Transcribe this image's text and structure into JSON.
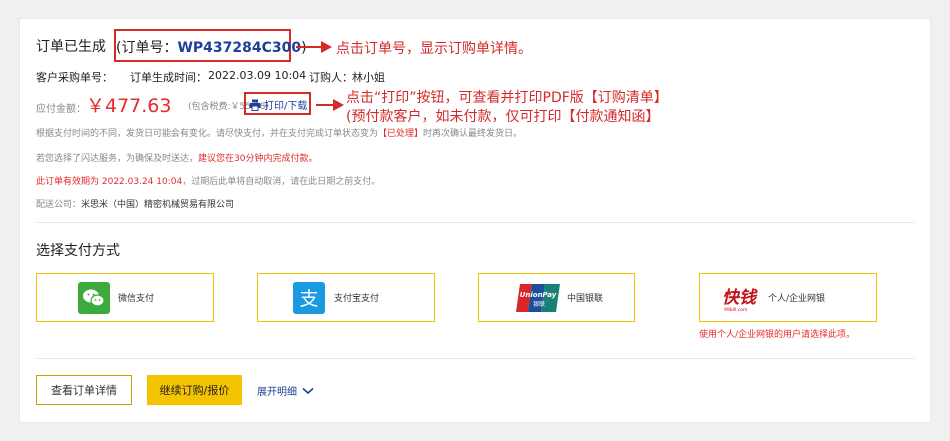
{
  "order": {
    "status_title": "订单已生成",
    "order_no_prefix": "(订单号：",
    "order_no": "WP437284C300",
    "order_no_suffix": ")",
    "annotation_order": "点击订单号，显示订购单详情。",
    "customer_po_label": "客户采购单号：",
    "created_time_label": "订单生成时间：",
    "created_time": "2022.03.09 10:04",
    "orderer_label": "订购人：",
    "orderer": "林小姐",
    "amount_label": "应付金额：",
    "amount": "￥477.63",
    "tax_note": "(包含税费:￥55.08)",
    "print_button": "打印/下载",
    "annotation_print_line1": "点击“打印”按钮，可查看并打印PDF版【订购清单】",
    "annotation_print_line2": "(预付款客户，如未付款，仅可打印【付款通知函】",
    "delivery_note_a": "根据支付时间的不同，发货日可能会有变化。请尽快支付，并在支付完成订单状态变为",
    "delivery_note_highlight": "【已处理】",
    "delivery_note_b": "时再次确认最终发货日。",
    "flash_note_a": "若您选择了闪达服务，为确保及时送达，",
    "flash_note_highlight": "建议您在30分钟内完成付款。",
    "validity_label": "此订单有效期为 2022.03.24 10:04",
    "validity_note": "，过期后此单将自动取消，请在此日期之前支付。",
    "shipper_label": "配送公司：",
    "shipper": "米思米（中国）精密机械贸易有限公司"
  },
  "payment": {
    "section_title": "选择支付方式",
    "methods": [
      {
        "label": "微信支付",
        "icon": "wechat-pay-icon"
      },
      {
        "label": "支付宝支付",
        "icon": "alipay-icon"
      },
      {
        "label": "中国银联",
        "icon": "unionpay-icon"
      },
      {
        "label": "个人/企业网银",
        "icon": "kuaiqian-icon"
      }
    ],
    "unionpay_logo_text": "UnionPay",
    "unionpay_logo_sub": "银联",
    "kuaiqian_logo_text": "快钱",
    "kuaiqian_logo_sub": "99bill.com",
    "netbank_tip": "使用个人/企业网银的用户请选择此项。"
  },
  "actions": {
    "view_details": "查看订单详情",
    "continue_order": "继续订购/报价",
    "expand": "展开明细"
  },
  "colors": {
    "accent_blue": "#1f3f98",
    "annotation_red": "#d42a2a",
    "price_red": "#e52b2b",
    "primary_yellow": "#f5c400",
    "card_border_yellow": "#f2c200"
  }
}
